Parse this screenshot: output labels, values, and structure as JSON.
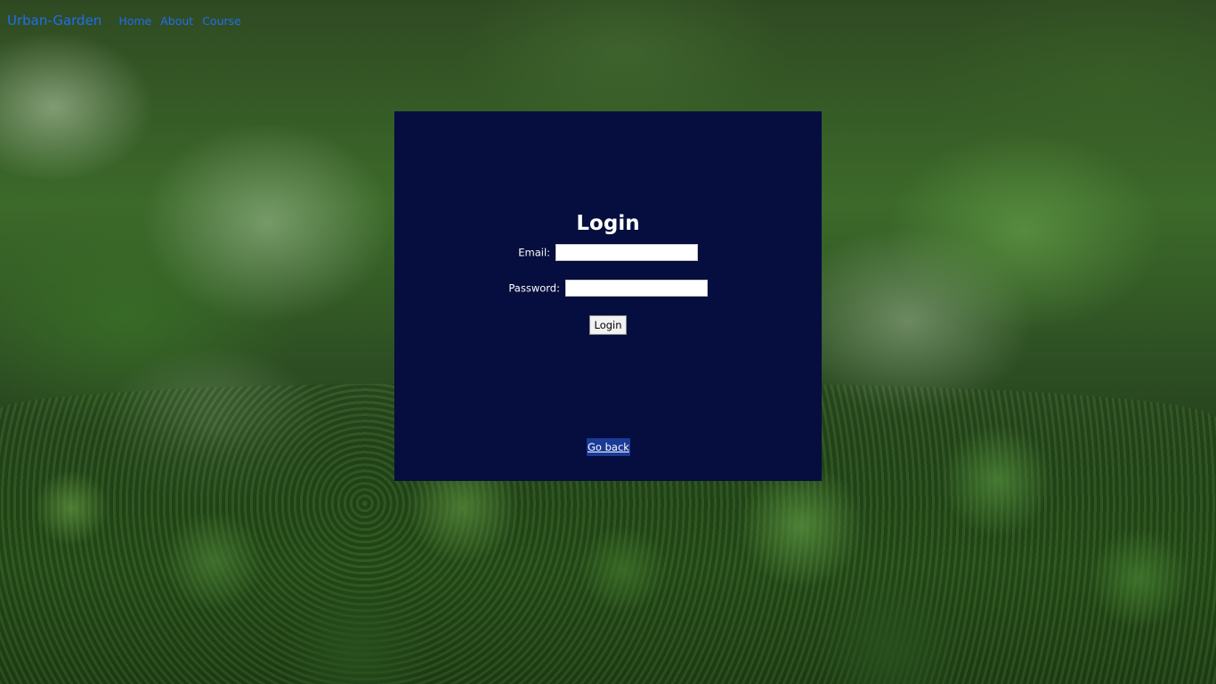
{
  "nav": {
    "brand": "Urban-Garden",
    "links": [
      {
        "label": "Home"
      },
      {
        "label": "About"
      },
      {
        "label": "Course"
      }
    ]
  },
  "login": {
    "title": "Login",
    "email_label": "Email:",
    "email_value": "",
    "password_label": "Password:",
    "password_value": "",
    "submit_label": "Login",
    "back_label": "Go back"
  },
  "colors": {
    "nav_link": "#1f6ef0",
    "panel_background": "#050e3e",
    "go_back_highlight": "#1a3a96"
  }
}
